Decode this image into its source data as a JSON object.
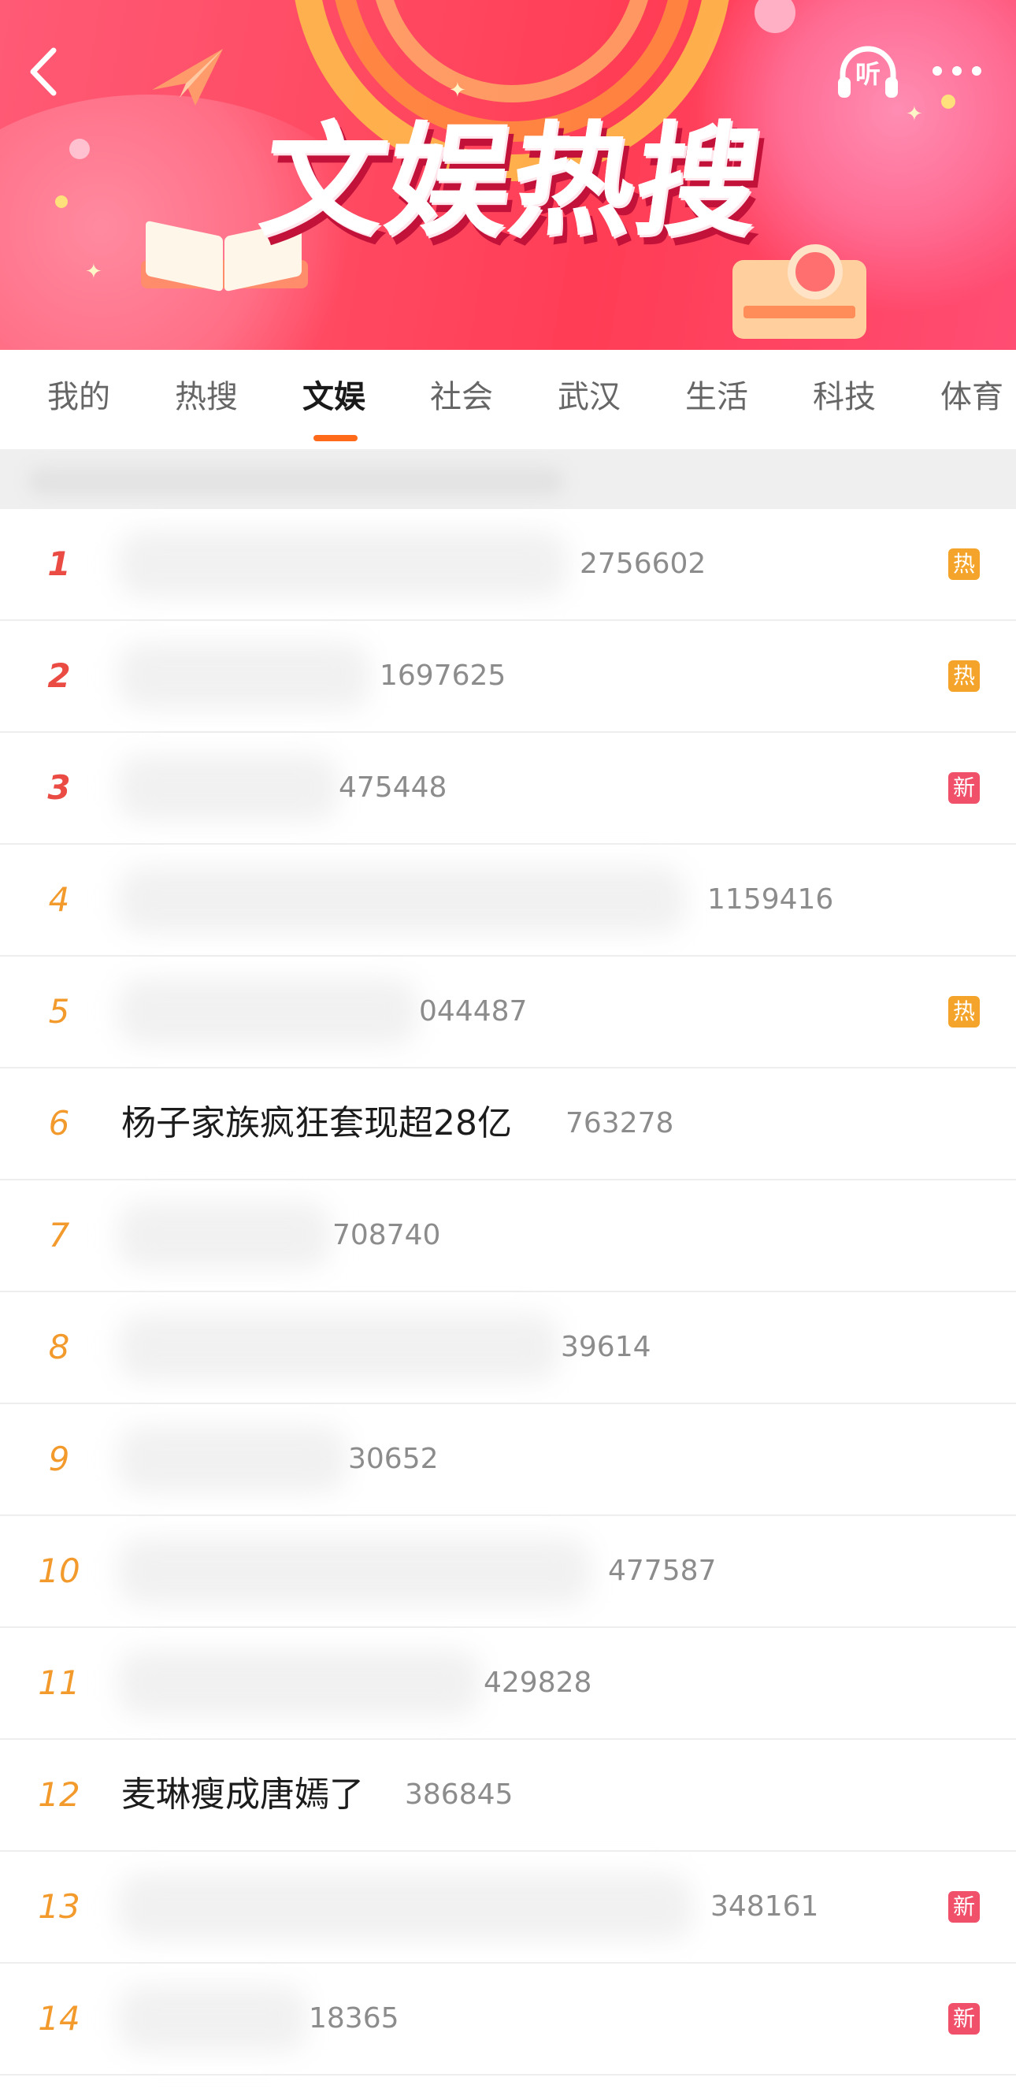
{
  "banner": {
    "title": "文娱热搜",
    "icons": {
      "back": "back-arrow-icon",
      "listen": "headphones-icon",
      "listen_label": "听",
      "more": "more-dots-icon"
    },
    "colors": {
      "background": "#ff4a62",
      "accent": "#ffc24a"
    }
  },
  "tabs": [
    {
      "label": "我的"
    },
    {
      "label": "热搜"
    },
    {
      "label": "文娱",
      "active": true
    },
    {
      "label": "社会"
    },
    {
      "label": "武汉"
    },
    {
      "label": "生活"
    },
    {
      "label": "科技"
    },
    {
      "label": "体育"
    }
  ],
  "list": {
    "items": [
      {
        "rank": "1",
        "topic": "",
        "count": "2756602",
        "badge": "热"
      },
      {
        "rank": "2",
        "topic": "",
        "count": "1697625",
        "badge": "热"
      },
      {
        "rank": "3",
        "topic": "",
        "count": "475448",
        "badge": "新"
      },
      {
        "rank": "4",
        "topic": "",
        "count": "1159416",
        "badge": ""
      },
      {
        "rank": "5",
        "topic": "",
        "count": "044487",
        "badge": "热"
      },
      {
        "rank": "6",
        "topic": "杨子家族疯狂套现超28亿",
        "count": "763278",
        "badge": ""
      },
      {
        "rank": "7",
        "topic": "",
        "count": "708740",
        "badge": ""
      },
      {
        "rank": "8",
        "topic": "",
        "count": "39614",
        "badge": ""
      },
      {
        "rank": "9",
        "topic": "",
        "count": "30652",
        "badge": ""
      },
      {
        "rank": "10",
        "topic": "",
        "count": "477587",
        "badge": ""
      },
      {
        "rank": "11",
        "topic": "",
        "count": "429828",
        "badge": ""
      },
      {
        "rank": "12",
        "topic": "麦琳瘦成唐嫣了",
        "count": "386845",
        "badge": ""
      },
      {
        "rank": "13",
        "topic": "",
        "count": "348161",
        "badge": "新"
      },
      {
        "rank": "14",
        "topic": "",
        "count": "18365",
        "badge": "新"
      }
    ],
    "colors": {
      "rank_top": "#ea4b43",
      "rank": "#f39a2c",
      "hot_badge": "#f5a42b",
      "new_badge": "#f0506a",
      "count": "#8c8c8c"
    }
  }
}
